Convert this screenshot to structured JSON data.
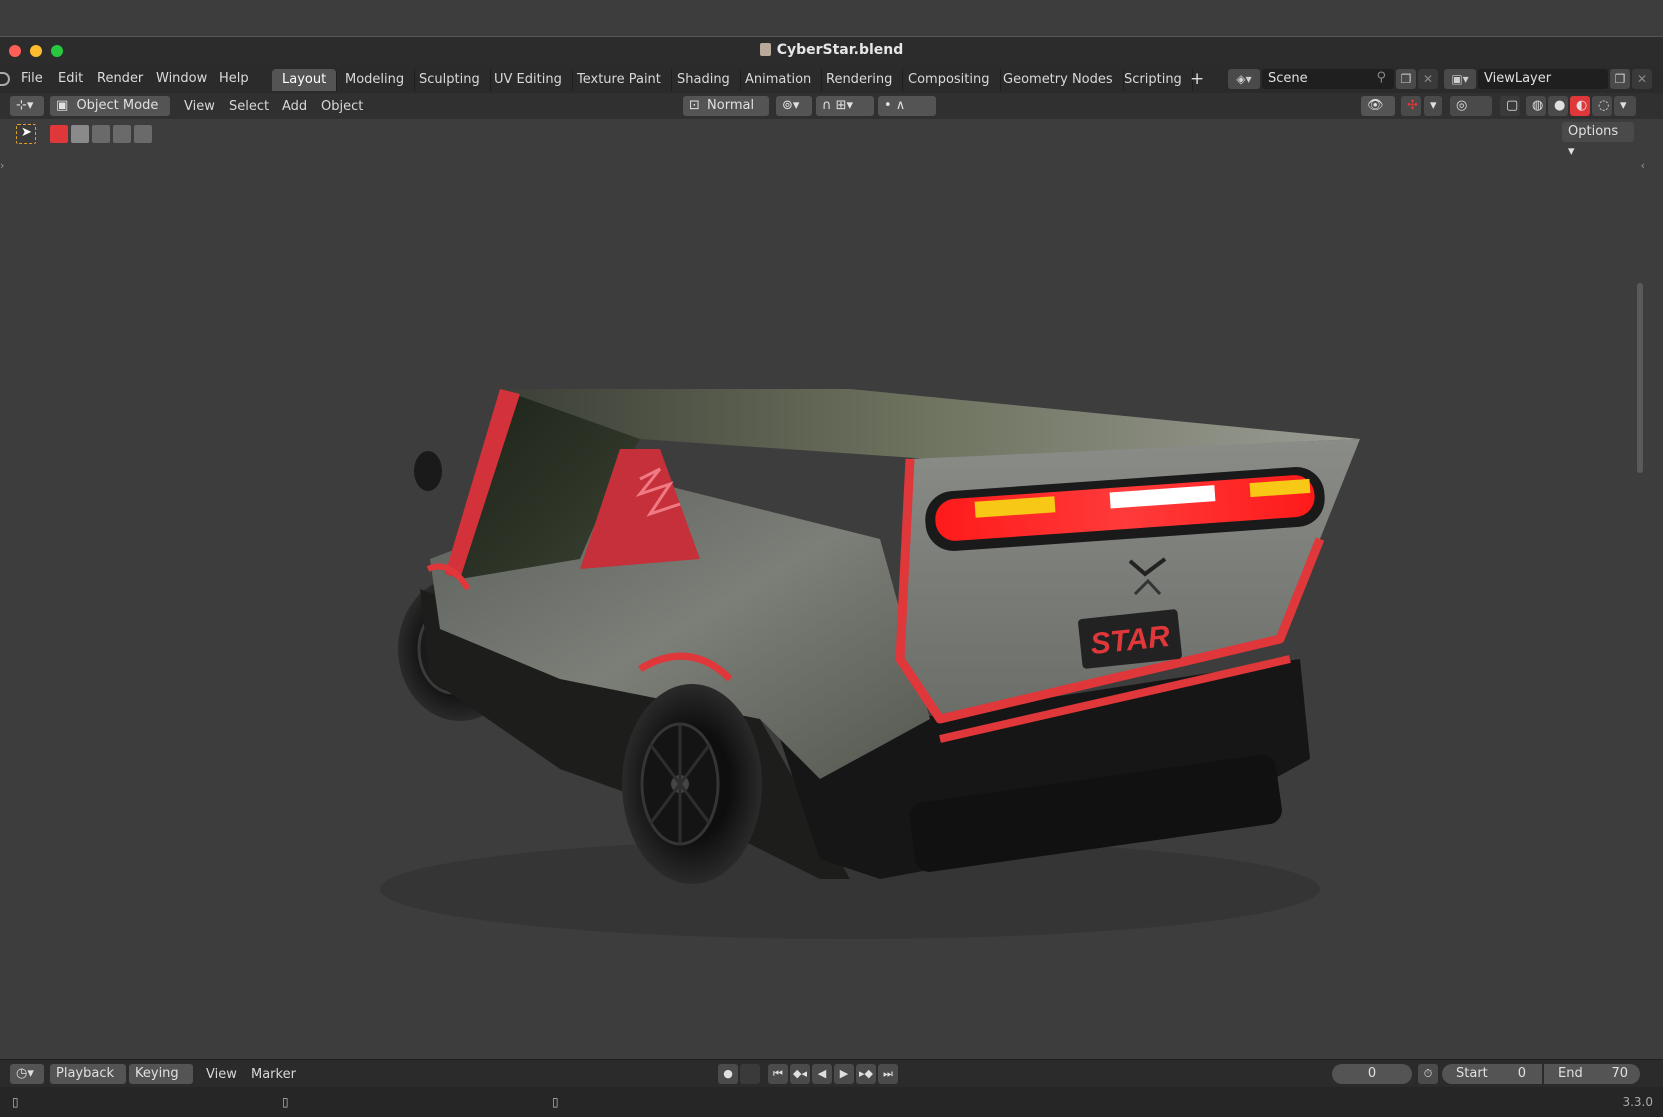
{
  "window": {
    "title": "CyberStar.blend"
  },
  "topbar": {
    "menus": [
      "File",
      "Edit",
      "Render",
      "Window",
      "Help"
    ],
    "workspaces": [
      "Layout",
      "Modeling",
      "Sculpting",
      "UV Editing",
      "Texture Paint",
      "Shading",
      "Animation",
      "Rendering",
      "Compositing",
      "Geometry Nodes",
      "Scripting"
    ],
    "add_workspace": "+",
    "scene": "Scene",
    "view_layer": "ViewLayer"
  },
  "viewport_header": {
    "mode": "Object Mode",
    "menus": [
      "View",
      "Select",
      "Add",
      "Object"
    ],
    "orientation": "Normal",
    "options": "Options"
  },
  "viewport": {
    "plate_text": "STAR",
    "background": "#3d3d3d",
    "accent": "#e0373a"
  },
  "timeline": {
    "playback": "Playback",
    "keying": "Keying",
    "view": "View",
    "marker": "Marker",
    "current_frame": "0",
    "start_label": "Start",
    "start": "0",
    "end_label": "End",
    "end": "70"
  },
  "status": {
    "version": "3.3.0"
  }
}
